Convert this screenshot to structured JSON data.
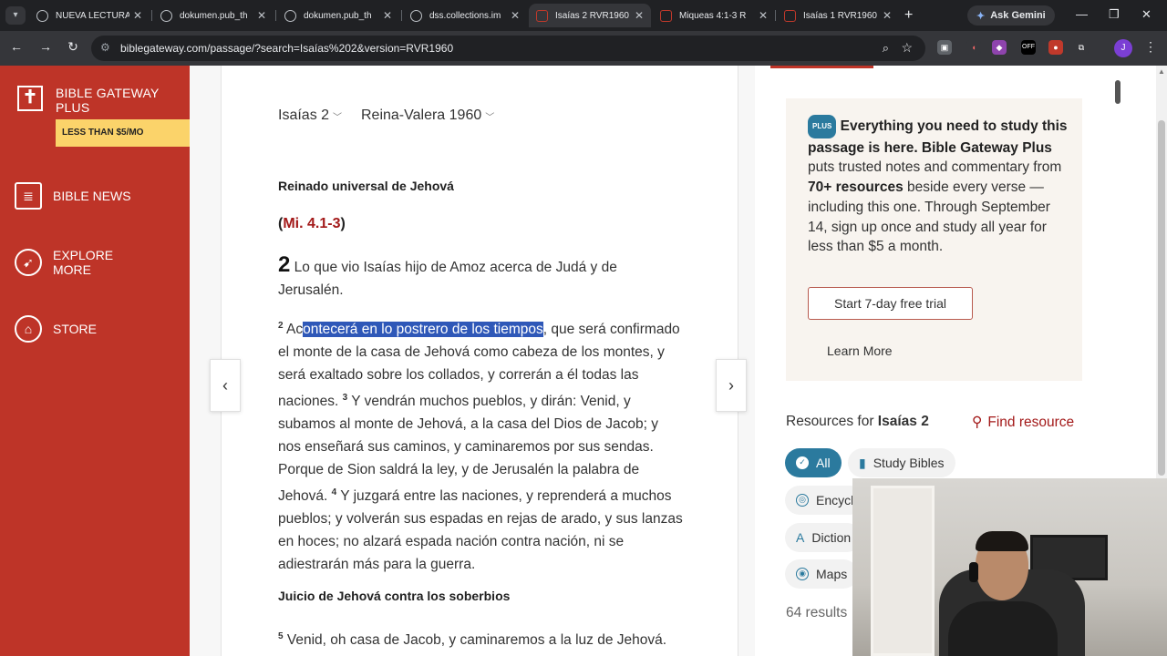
{
  "browser": {
    "tabs": [
      {
        "title": "NUEVA LECTURA",
        "active": false
      },
      {
        "title": "dokumen.pub_th",
        "active": false
      },
      {
        "title": "dokumen.pub_th",
        "active": false
      },
      {
        "title": "dss.collections.im",
        "active": false
      },
      {
        "title": "Isaías 2 RVR1960",
        "active": true
      },
      {
        "title": "Miqueas 4:1-3 R",
        "active": false
      },
      {
        "title": "Isaías 1 RVR1960",
        "active": false
      }
    ],
    "gemini_label": "Ask Gemini",
    "url": "biblegateway.com/passage/?search=Isaías%202&version=RVR1960",
    "avatar_initial": "J",
    "ext_badge": "OFF"
  },
  "sidebar": {
    "plus_title": "BIBLE GATEWAY PLUS",
    "plus_badge": "LESS THAN $5/MO",
    "items": [
      {
        "label": "BIBLE NEWS",
        "icon": "news-icon"
      },
      {
        "label": "EXPLORE MORE",
        "icon": "compass-icon"
      },
      {
        "label": "STORE",
        "icon": "store-icon"
      }
    ]
  },
  "passage": {
    "book_selector": "Isaías 2",
    "version_selector": "Reina-Valera 1960",
    "heading1": "Reinado universal de Jehová",
    "xref_open": "(",
    "xref_link": "Mi. 4.1-3",
    "xref_close": ")",
    "chapter_num": "2",
    "verse1": "Lo que vio Isaías hijo de Amoz acerca de Judá y de Jerusalén.",
    "verse2_num": "2",
    "verse2_pre": "Ac",
    "verse2_highlight": "ontecerá en lo postrero de los tiempos",
    "verse2_post": ", que será confirmado el monte de la casa de Jehová como cabeza de los montes, y será exaltado sobre los collados, y correrán a él todas las naciones.",
    "verse3_num": "3",
    "verse3": "Y vendrán muchos pueblos, y dirán: Venid, y subamos al monte de Jehová, a la casa del Dios de Jacob; y nos enseñará sus caminos, y caminaremos por sus sendas. Porque de Sion saldrá la ley, y de Jerusalén la palabra de Jehová.",
    "verse4_num": "4",
    "verse4": "Y juzgará entre las naciones, y reprenderá a muchos pueblos; y volverán sus espadas en rejas de arado, y sus lanzas en hoces; no alzará espada nación contra nación, ni se adiestrarán más para la guerra.",
    "heading2": "Juicio de Jehová contra los soberbios",
    "verse5_num": "5",
    "verse5": "Venid, oh casa de Jacob, y caminaremos a la luz de Jehová."
  },
  "promo": {
    "plus_pill": "PLUS",
    "bold_lead": "Everything you need to study this passage is here. Bible Gateway Plus",
    "text_a": " puts trusted notes and commentary from ",
    "bold_count": "70+ resources",
    "text_b": " beside every verse — including this one. Through September 14, sign up once and study all year for less than $5 a month.",
    "trial_button": "Start 7-day free trial",
    "learn_more": "Learn More"
  },
  "resources": {
    "heading_prefix": "Resources for ",
    "heading_ref": "Isaías 2",
    "find_label": "Find resource",
    "filters": [
      {
        "label": "All",
        "active": true
      },
      {
        "label": "Study Bibles",
        "active": false
      },
      {
        "label": "Encycl",
        "active": false
      },
      {
        "label": "Diction",
        "active": false
      },
      {
        "label": "Maps",
        "active": false
      }
    ],
    "results": "64 results"
  }
}
